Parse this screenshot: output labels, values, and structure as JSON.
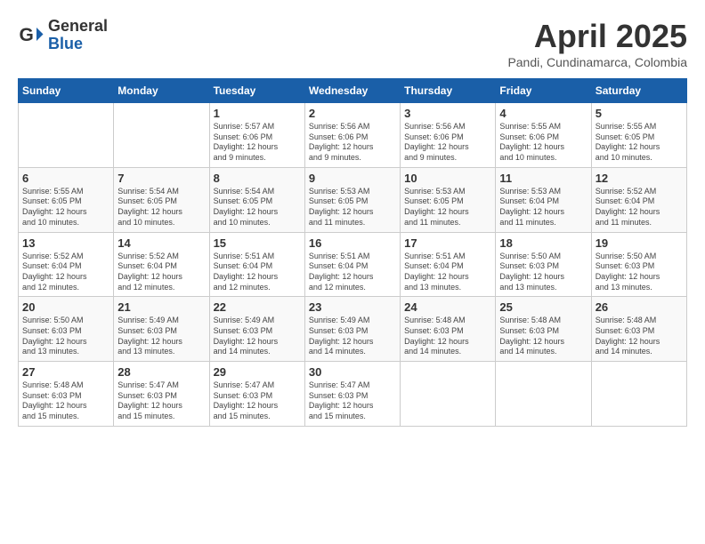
{
  "logo": {
    "general": "General",
    "blue": "Blue"
  },
  "title": "April 2025",
  "subtitle": "Pandi, Cundinamarca, Colombia",
  "days_header": [
    "Sunday",
    "Monday",
    "Tuesday",
    "Wednesday",
    "Thursday",
    "Friday",
    "Saturday"
  ],
  "weeks": [
    [
      {
        "day": "",
        "info": ""
      },
      {
        "day": "",
        "info": ""
      },
      {
        "day": "1",
        "info": "Sunrise: 5:57 AM\nSunset: 6:06 PM\nDaylight: 12 hours\nand 9 minutes."
      },
      {
        "day": "2",
        "info": "Sunrise: 5:56 AM\nSunset: 6:06 PM\nDaylight: 12 hours\nand 9 minutes."
      },
      {
        "day": "3",
        "info": "Sunrise: 5:56 AM\nSunset: 6:06 PM\nDaylight: 12 hours\nand 9 minutes."
      },
      {
        "day": "4",
        "info": "Sunrise: 5:55 AM\nSunset: 6:06 PM\nDaylight: 12 hours\nand 10 minutes."
      },
      {
        "day": "5",
        "info": "Sunrise: 5:55 AM\nSunset: 6:05 PM\nDaylight: 12 hours\nand 10 minutes."
      }
    ],
    [
      {
        "day": "6",
        "info": "Sunrise: 5:55 AM\nSunset: 6:05 PM\nDaylight: 12 hours\nand 10 minutes."
      },
      {
        "day": "7",
        "info": "Sunrise: 5:54 AM\nSunset: 6:05 PM\nDaylight: 12 hours\nand 10 minutes."
      },
      {
        "day": "8",
        "info": "Sunrise: 5:54 AM\nSunset: 6:05 PM\nDaylight: 12 hours\nand 10 minutes."
      },
      {
        "day": "9",
        "info": "Sunrise: 5:53 AM\nSunset: 6:05 PM\nDaylight: 12 hours\nand 11 minutes."
      },
      {
        "day": "10",
        "info": "Sunrise: 5:53 AM\nSunset: 6:05 PM\nDaylight: 12 hours\nand 11 minutes."
      },
      {
        "day": "11",
        "info": "Sunrise: 5:53 AM\nSunset: 6:04 PM\nDaylight: 12 hours\nand 11 minutes."
      },
      {
        "day": "12",
        "info": "Sunrise: 5:52 AM\nSunset: 6:04 PM\nDaylight: 12 hours\nand 11 minutes."
      }
    ],
    [
      {
        "day": "13",
        "info": "Sunrise: 5:52 AM\nSunset: 6:04 PM\nDaylight: 12 hours\nand 12 minutes."
      },
      {
        "day": "14",
        "info": "Sunrise: 5:52 AM\nSunset: 6:04 PM\nDaylight: 12 hours\nand 12 minutes."
      },
      {
        "day": "15",
        "info": "Sunrise: 5:51 AM\nSunset: 6:04 PM\nDaylight: 12 hours\nand 12 minutes."
      },
      {
        "day": "16",
        "info": "Sunrise: 5:51 AM\nSunset: 6:04 PM\nDaylight: 12 hours\nand 12 minutes."
      },
      {
        "day": "17",
        "info": "Sunrise: 5:51 AM\nSunset: 6:04 PM\nDaylight: 12 hours\nand 13 minutes."
      },
      {
        "day": "18",
        "info": "Sunrise: 5:50 AM\nSunset: 6:03 PM\nDaylight: 12 hours\nand 13 minutes."
      },
      {
        "day": "19",
        "info": "Sunrise: 5:50 AM\nSunset: 6:03 PM\nDaylight: 12 hours\nand 13 minutes."
      }
    ],
    [
      {
        "day": "20",
        "info": "Sunrise: 5:50 AM\nSunset: 6:03 PM\nDaylight: 12 hours\nand 13 minutes."
      },
      {
        "day": "21",
        "info": "Sunrise: 5:49 AM\nSunset: 6:03 PM\nDaylight: 12 hours\nand 13 minutes."
      },
      {
        "day": "22",
        "info": "Sunrise: 5:49 AM\nSunset: 6:03 PM\nDaylight: 12 hours\nand 14 minutes."
      },
      {
        "day": "23",
        "info": "Sunrise: 5:49 AM\nSunset: 6:03 PM\nDaylight: 12 hours\nand 14 minutes."
      },
      {
        "day": "24",
        "info": "Sunrise: 5:48 AM\nSunset: 6:03 PM\nDaylight: 12 hours\nand 14 minutes."
      },
      {
        "day": "25",
        "info": "Sunrise: 5:48 AM\nSunset: 6:03 PM\nDaylight: 12 hours\nand 14 minutes."
      },
      {
        "day": "26",
        "info": "Sunrise: 5:48 AM\nSunset: 6:03 PM\nDaylight: 12 hours\nand 14 minutes."
      }
    ],
    [
      {
        "day": "27",
        "info": "Sunrise: 5:48 AM\nSunset: 6:03 PM\nDaylight: 12 hours\nand 15 minutes."
      },
      {
        "day": "28",
        "info": "Sunrise: 5:47 AM\nSunset: 6:03 PM\nDaylight: 12 hours\nand 15 minutes."
      },
      {
        "day": "29",
        "info": "Sunrise: 5:47 AM\nSunset: 6:03 PM\nDaylight: 12 hours\nand 15 minutes."
      },
      {
        "day": "30",
        "info": "Sunrise: 5:47 AM\nSunset: 6:03 PM\nDaylight: 12 hours\nand 15 minutes."
      },
      {
        "day": "",
        "info": ""
      },
      {
        "day": "",
        "info": ""
      },
      {
        "day": "",
        "info": ""
      }
    ]
  ]
}
